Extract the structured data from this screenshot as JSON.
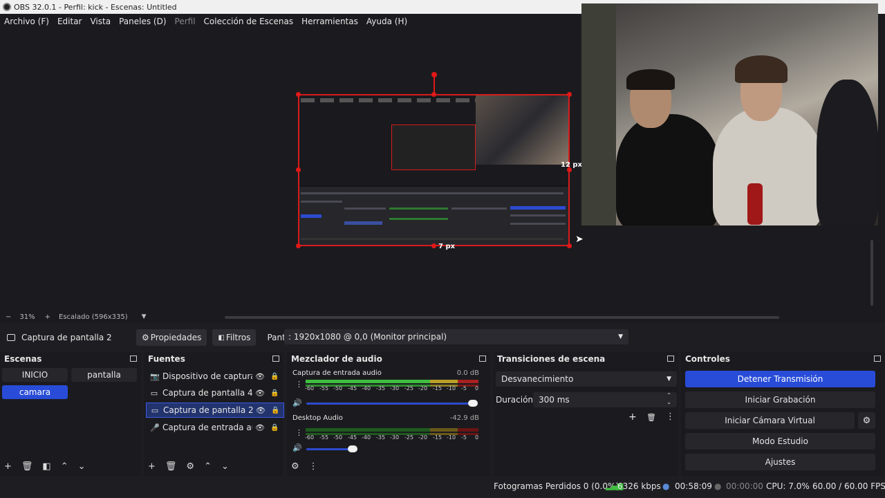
{
  "window": {
    "title": "OBS 32.0.1 - Perfil: kick - Escenas: Untitled"
  },
  "menu": [
    {
      "label": "Archivo (F)",
      "disabled": false
    },
    {
      "label": "Editar",
      "disabled": false
    },
    {
      "label": "Vista",
      "disabled": false
    },
    {
      "label": "Paneles (D)",
      "disabled": false
    },
    {
      "label": "Perfil",
      "disabled": true
    },
    {
      "label": "Colección de Escenas",
      "disabled": false
    },
    {
      "label": "Herramientas",
      "disabled": false
    },
    {
      "label": "Ayuda (H)",
      "disabled": false
    }
  ],
  "preview": {
    "offset_right_label": "12 px",
    "offset_bottom_label": "7 px"
  },
  "scale": {
    "zoom": "31%",
    "scaling": "Escalado (596x335)"
  },
  "source_toolbar": {
    "selected_source": "Captura de pantalla 2",
    "properties_label": "Propiedades",
    "filters_label": "Filtros",
    "display_label": "Pantalla",
    "display_value": ": 1920x1080 @ 0,0 (Monitor principal)"
  },
  "scenes": {
    "title": "Escenas",
    "items": [
      {
        "label": "INICIO",
        "active": false
      },
      {
        "label": "pantalla",
        "active": false
      },
      {
        "label": "camara",
        "active": true
      }
    ]
  },
  "sources": {
    "title": "Fuentes",
    "items": [
      {
        "label": "Dispositivo de captura de",
        "icon": "camera-icon",
        "active": false
      },
      {
        "label": "Captura de pantalla 4",
        "icon": "monitor-icon",
        "active": false
      },
      {
        "label": "Captura de pantalla 2",
        "icon": "monitor-icon",
        "active": true
      },
      {
        "label": "Captura de entrada audic",
        "icon": "microphone-icon",
        "active": false
      }
    ]
  },
  "mixer": {
    "title": "Mezclador de audio",
    "channels": [
      {
        "name": "Captura de entrada audio",
        "db": "0.0 dB",
        "volume_fraction": 0.97
      },
      {
        "name": "Desktop Audio",
        "db": "-42.9 dB",
        "volume_fraction": 0.27
      }
    ],
    "scale_ticks": [
      "-60",
      "-55",
      "-50",
      "-45",
      "-40",
      "-35",
      "-30",
      "-25",
      "-20",
      "-15",
      "-10",
      "-5",
      "0"
    ]
  },
  "transitions": {
    "title": "Transiciones de escena",
    "selected": "Desvanecimiento",
    "duration_label": "Duración",
    "duration_value": "300 ms"
  },
  "controls": {
    "title": "Controles",
    "buttons": [
      {
        "label": "Detener Transmisión",
        "primary": true
      },
      {
        "label": "Iniciar Grabación",
        "primary": false
      },
      {
        "label": "Iniciar Cámara Virtual",
        "primary": false
      },
      {
        "label": "Modo Estudio",
        "primary": false
      },
      {
        "label": "Ajustes",
        "primary": false
      }
    ]
  },
  "status": {
    "dropped_frames": "Fotogramas Perdidos 0 (0.0%)",
    "bitrate": "6326 kbps",
    "stream_time": "00:58:09",
    "record_time": "00:00:00",
    "cpu": "CPU: 7.0%",
    "fps": "60.00 / 60.00 FPS"
  },
  "colors": {
    "accent": "#284cd8",
    "selection": "#d91b1b",
    "bg": "#1b1b1f"
  }
}
